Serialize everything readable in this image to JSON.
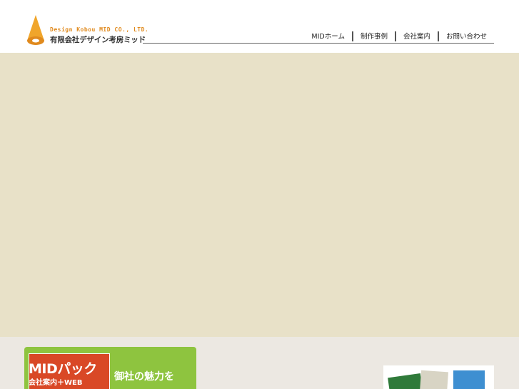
{
  "logo": {
    "name_en": "Design Kobou MID CO., LTD.",
    "name_jp": "有限会社デザイン考房ミッド",
    "accent_color": "#e08a1e"
  },
  "nav": {
    "items": [
      {
        "label": "MIDホーム"
      },
      {
        "label": "制作事例"
      },
      {
        "label": "会社案内"
      },
      {
        "label": "お問い合わせ"
      }
    ]
  },
  "hero": {
    "background_color": "#e8e1c8"
  },
  "promo": {
    "title": "MIDパック",
    "subtitle": "会社案内＋WEB",
    "tagline": "御社の魅力を",
    "background_color": "#8ec43f",
    "box_color": "#d94826"
  },
  "content": {
    "text_line": "□□□□□□□□□□□□□□□□□□□□□□□□□□□□□□□□□□□□"
  }
}
